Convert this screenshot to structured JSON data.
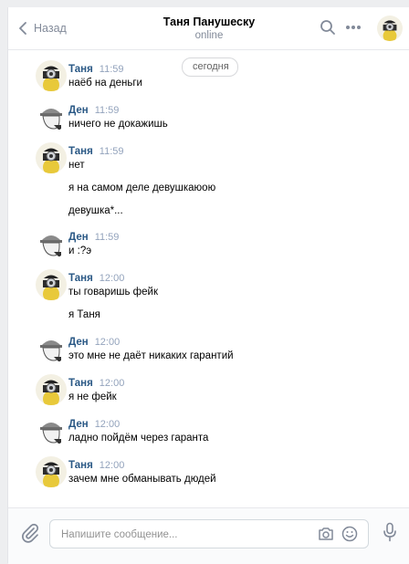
{
  "header": {
    "back_label": "Назад",
    "title": "Таня Панушеску",
    "status": "online"
  },
  "chat": {
    "date_label": "сегодня",
    "messages": [
      {
        "author": "Таня",
        "time": "11:59",
        "lines": [
          "наёб на деньги"
        ],
        "avatar": "minion-avatar"
      },
      {
        "author": "Ден",
        "time": "11:59",
        "lines": [
          "ничего не докажишь"
        ],
        "avatar": "detective-avatar"
      },
      {
        "author": "Таня",
        "time": "11:59",
        "lines": [
          "нет",
          "я на самом деле девушкаюою",
          "девушка*..."
        ],
        "avatar": "minion-avatar"
      },
      {
        "author": "Ден",
        "time": "11:59",
        "lines": [
          "и :?э"
        ],
        "avatar": "detective-avatar"
      },
      {
        "author": "Таня",
        "time": "12:00",
        "lines": [
          "ты говаришь фейк",
          "я Таня"
        ],
        "avatar": "minion-avatar"
      },
      {
        "author": "Ден",
        "time": "12:00",
        "lines": [
          "это мне не даёт никаких гарантий"
        ],
        "avatar": "detective-avatar"
      },
      {
        "author": "Таня",
        "time": "12:00",
        "lines": [
          "я не фейк"
        ],
        "avatar": "minion-avatar"
      },
      {
        "author": "Ден",
        "time": "12:00",
        "lines": [
          "ладно пойдём через гаранта"
        ],
        "avatar": "detective-avatar"
      },
      {
        "author": "Таня",
        "time": "12:00",
        "lines": [
          "зачем мне обманывать дюдей"
        ],
        "avatar": "minion-avatar"
      }
    ]
  },
  "composer": {
    "placeholder": "Напишите сообщение..."
  },
  "icons": {
    "back": "chevron-left-icon",
    "search": "search-icon",
    "more": "more-icon",
    "attach": "paperclip-icon",
    "camera": "camera-icon",
    "emoji": "smile-icon",
    "mic": "microphone-icon"
  },
  "colors": {
    "author": "#2a5885",
    "time": "#93a3bc",
    "muted": "#828a99",
    "background": "#edeef0"
  }
}
